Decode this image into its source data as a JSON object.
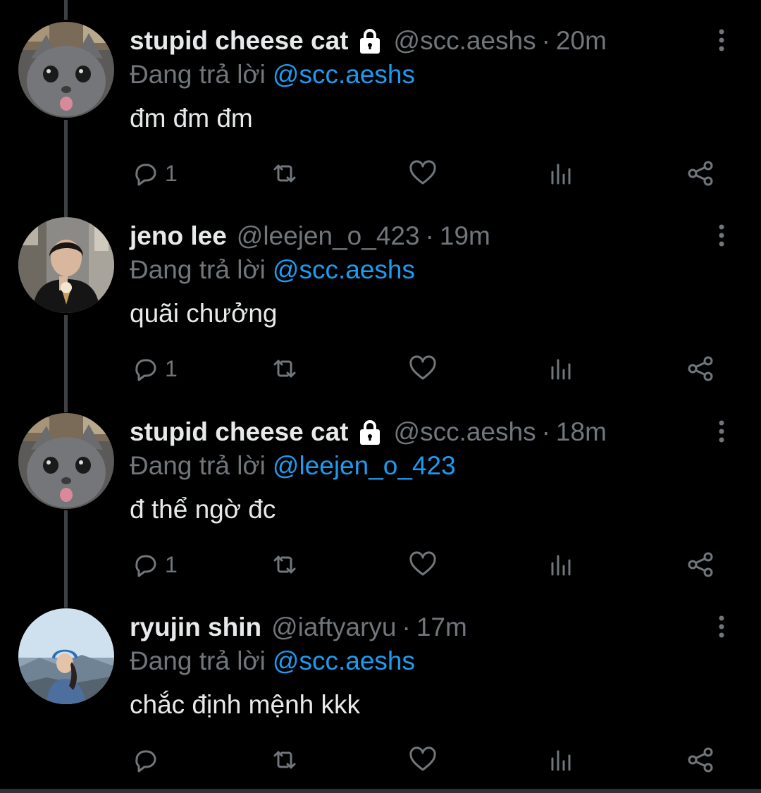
{
  "reply_prefix": "Đang trả lời",
  "separator": "·",
  "colors": {
    "background": "#000000",
    "text_primary": "#e7e9ea",
    "text_secondary": "#71767b",
    "link": "#1d9bf0",
    "thread_line": "#3e4144"
  },
  "tweets": [
    {
      "display_name": "stupid cheese cat",
      "protected": true,
      "handle": "@scc.aeshs",
      "time": "20m",
      "reply_to": "@scc.aeshs",
      "text": "đm đm đm",
      "reply_count": "1",
      "avatar": "gray-cat-avatar"
    },
    {
      "display_name": "jeno lee",
      "protected": false,
      "handle": "@leejen_o_423",
      "time": "19m",
      "reply_to": "@scc.aeshs",
      "text": "quãi chưởng",
      "reply_count": "1",
      "avatar": "person-with-ice-cream-avatar"
    },
    {
      "display_name": "stupid cheese cat",
      "protected": true,
      "handle": "@scc.aeshs",
      "time": "18m",
      "reply_to": "@leejen_o_423",
      "text": "đ thể ngờ đc",
      "reply_count": "1",
      "avatar": "gray-cat-avatar"
    },
    {
      "display_name": "ryujin shin",
      "protected": false,
      "handle": "@iaftyaryu",
      "time": "17m",
      "reply_to": "@scc.aeshs",
      "text": "chắc định mệnh kkk",
      "reply_count": "",
      "avatar": "woman-mountain-avatar"
    }
  ]
}
